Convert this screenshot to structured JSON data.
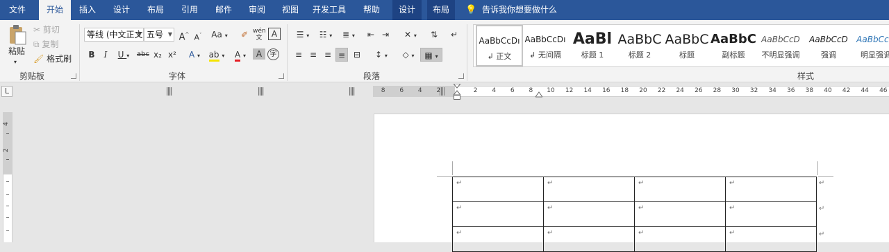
{
  "tabs": [
    {
      "label": "文件",
      "active": false
    },
    {
      "label": "开始",
      "active": true
    },
    {
      "label": "插入",
      "active": false
    },
    {
      "label": "设计",
      "active": false
    },
    {
      "label": "布局",
      "active": false
    },
    {
      "label": "引用",
      "active": false
    },
    {
      "label": "邮件",
      "active": false
    },
    {
      "label": "审阅",
      "active": false
    },
    {
      "label": "视图",
      "active": false
    },
    {
      "label": "开发工具",
      "active": false
    },
    {
      "label": "帮助",
      "active": false
    },
    {
      "label": "设计",
      "active": false,
      "contextual": true
    },
    {
      "label": "布局",
      "active": false,
      "contextual": true
    }
  ],
  "tell_me": "告诉我你想要做什么",
  "clipboard": {
    "group_label": "剪贴板",
    "paste": "粘贴",
    "cut": "剪切",
    "copy": "复制",
    "format_painter": "格式刷"
  },
  "font": {
    "group_label": "字体",
    "font_name": "等线 (中文正文)",
    "font_size": "五号",
    "grow": "A",
    "shrink": "A",
    "change_case": "Aa",
    "bold": "B",
    "italic": "I",
    "underline": "U",
    "strike": "abc",
    "subscript": "x₂",
    "superscript": "x²"
  },
  "paragraph": {
    "group_label": "段落"
  },
  "styles": {
    "group_label": "样式",
    "items": [
      {
        "preview": "AaBbCcDı",
        "name": "↲ 正文",
        "selected": true
      },
      {
        "preview": "AaBbCcDı",
        "name": "↲ 无间隔",
        "selected": false
      },
      {
        "preview": "AaBl",
        "name": "标题 1",
        "selected": false
      },
      {
        "preview": "AaBbC",
        "name": "标题 2",
        "selected": false
      },
      {
        "preview": "AaBbC",
        "name": "标题",
        "selected": false
      },
      {
        "preview": "AaBbC",
        "name": "副标题",
        "selected": false
      },
      {
        "preview": "AaBbCcD",
        "name": "不明显强调",
        "selected": false
      },
      {
        "preview": "AaBbCcD",
        "name": "强调",
        "selected": false
      },
      {
        "preview": "AaBbCcD",
        "name": "明显强调",
        "selected": false
      }
    ]
  },
  "ruler": {
    "corner": "L",
    "left_ticks": [
      "8",
      "6",
      "4",
      "2"
    ],
    "right_ticks": [
      "2",
      "4",
      "6",
      "8",
      "10",
      "12",
      "14",
      "16",
      "18",
      "20",
      "22",
      "24",
      "26",
      "28",
      "30",
      "32",
      "34",
      "36",
      "38",
      "40",
      "42",
      "44",
      "46"
    ],
    "vertical_ticks": [
      "4",
      "2"
    ]
  },
  "document": {
    "cell_mark": "↵",
    "rows": [
      [
        "↵",
        "↵",
        "↵",
        "↵"
      ],
      [
        "↵",
        "↵",
        "↵",
        "↵"
      ],
      [
        "↵",
        "↵",
        "↵",
        "↵"
      ]
    ]
  }
}
